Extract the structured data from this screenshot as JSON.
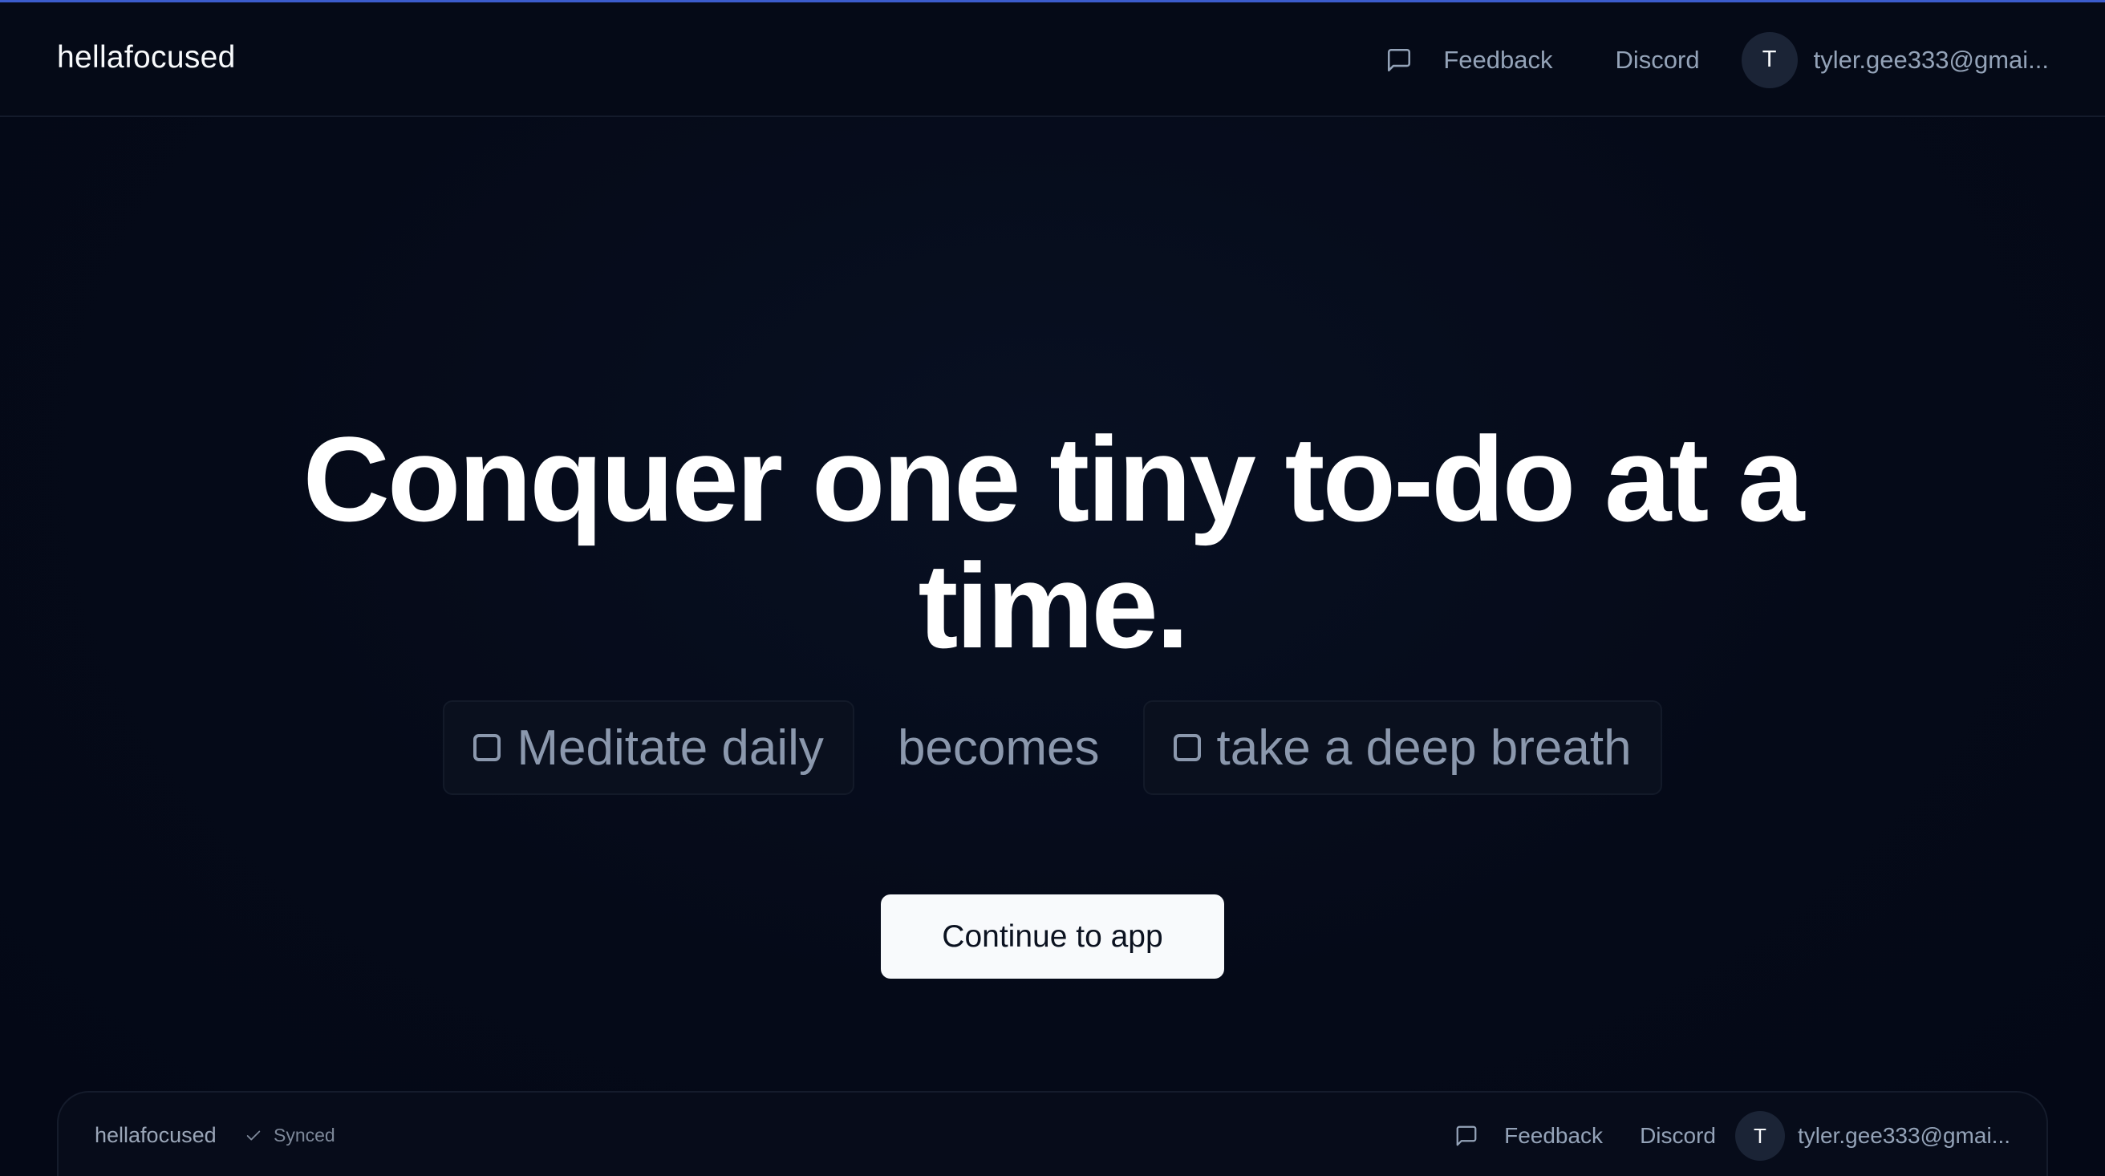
{
  "colors": {
    "background": "#050a18",
    "accent_line": "#3b5ccc",
    "primary_text": "#f8fafc",
    "muted_text": "#94a3b8",
    "button_bg": "#f8fafc"
  },
  "header": {
    "brand": "hellafocused",
    "feedback_label": "Feedback",
    "feedback_icon": "message-square-icon",
    "discord_label": "Discord",
    "avatar_initial": "T",
    "user_email": "tyler.gee333@gmai..."
  },
  "hero": {
    "title_line1": "Conquer one tiny to-do at a",
    "title_line2": "time.",
    "example_before": "Meditate daily",
    "connector": "becomes",
    "example_after": "take a deep breath",
    "cta_label": "Continue to app"
  },
  "preview": {
    "brand": "hellafocused",
    "status": "Synced",
    "status_icon": "check-icon",
    "feedback_label": "Feedback",
    "discord_label": "Discord",
    "avatar_initial": "T",
    "user_email": "tyler.gee333@gmai..."
  }
}
